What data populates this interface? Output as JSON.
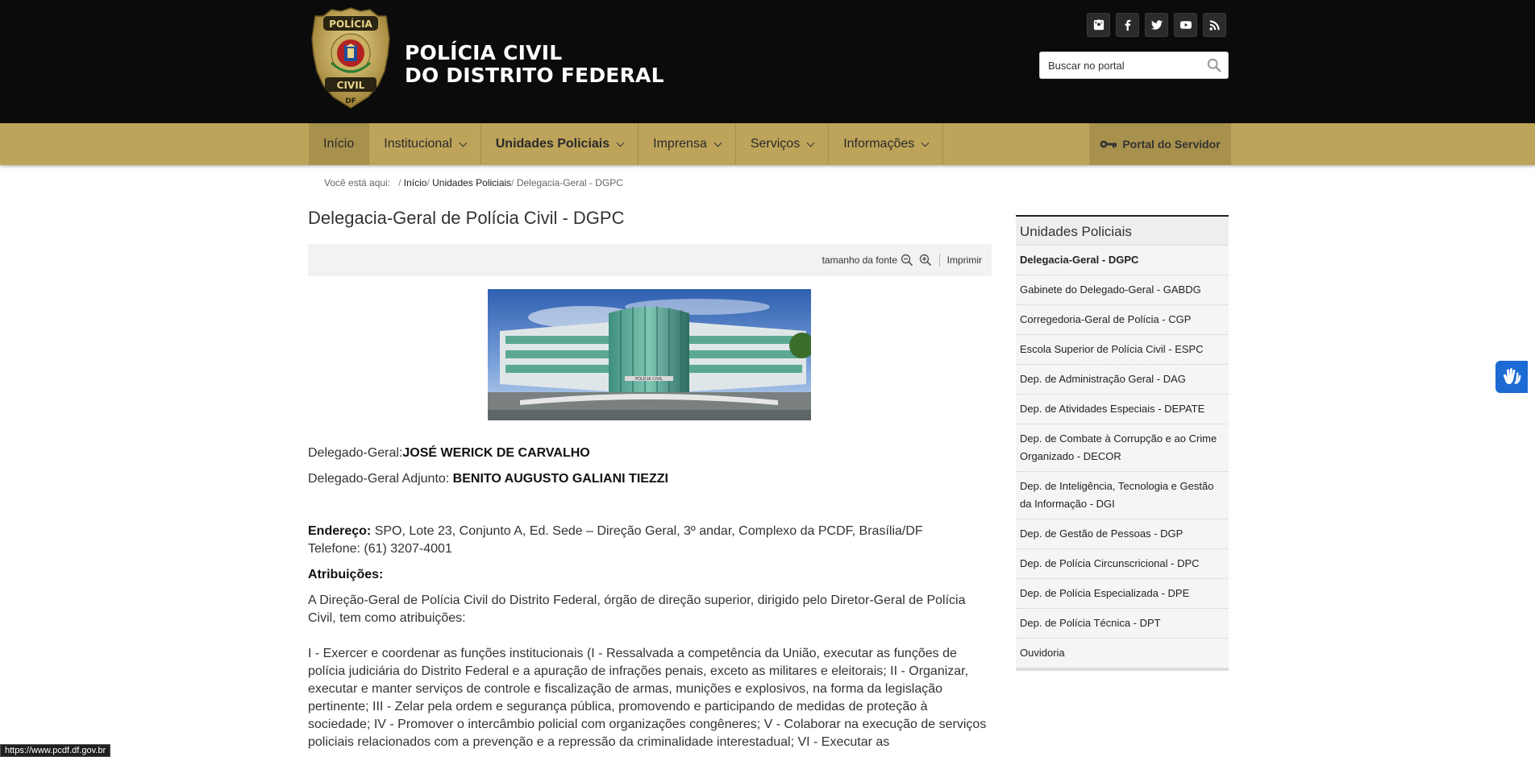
{
  "header": {
    "brand_line1": "POLÍCIA CIVIL",
    "brand_line2": "DO DISTRITO FEDERAL",
    "badge_text_top": "POLÍCIA",
    "badge_text_bottom": "CIVIL",
    "badge_text_df": "DF",
    "search_placeholder": "Buscar no portal",
    "socials": [
      "instagram-icon",
      "facebook-icon",
      "twitter-icon",
      "youtube-icon",
      "rss-icon"
    ]
  },
  "nav": {
    "items": [
      {
        "label": "Início"
      },
      {
        "label": "Institucional"
      },
      {
        "label": "Unidades Policiais"
      },
      {
        "label": "Imprensa"
      },
      {
        "label": "Serviços"
      },
      {
        "label": "Informações"
      }
    ],
    "portal_label": "Portal do Servidor"
  },
  "breadcrumb": {
    "prefix": "Você está aqui:",
    "home": "Início",
    "section": "Unidades Policiais",
    "current": "Delegacia-Geral - DGPC"
  },
  "main": {
    "title": "Delegacia-Geral de Polícia Civil - DGPC",
    "font_size_label": "tamanho da fonte",
    "print_label": "Imprimir",
    "building_sign": "POLÍCIA CIVIL",
    "delegado_label": "Delegado-Geral:",
    "delegado_name": "JOSÉ WERICK DE CARVALHO",
    "adjunto_label": "Delegado-Geral Adjunto: ",
    "adjunto_name": "BENITO AUGUSTO GALIANI TIEZZI",
    "endereco_label": "Endereço:",
    "endereco_value": " SPO, Lote 23, Conjunto A, Ed. Sede – Direção Geral, 3º andar, Complexo da PCDF, Brasília/DF",
    "telefone": "Telefone: (61) 3207-4001",
    "atribuicoes_label": "Atribuições:",
    "intro": "A Direção-Geral de Polícia Civil do Distrito Federal, órgão de direção superior, dirigido pelo Diretor-Geral de Polícia Civil, tem como atribuições:",
    "body": "I - Exercer e coordenar as funções institucionais (I - Ressalvada a competência da União, executar as funções de polícia judiciária do Distrito Federal e a apuração de infrações penais, exceto as militares e eleitorais; II - Organizar, executar e manter serviços de controle e fiscalização de armas, munições e explosivos, na forma da legislação pertinente; III - Zelar pela ordem e segurança pública, promovendo e participando de medidas de proteção à sociedade; IV - Promover o intercâmbio policial com organizações congêneres; V - Colaborar na execução de serviços policiais relacionados com a prevenção e a repressão da criminalidade interestadual; VI - Executar as"
  },
  "sidebar": {
    "title": "Unidades Policiais",
    "items": [
      "Delegacia-Geral - DGPC",
      "Gabinete do Delegado-Geral - GABDG",
      "Corregedoria-Geral de Polícia - CGP",
      "Escola Superior de Polícia Civil - ESPC",
      "Dep. de Administração Geral - DAG",
      "Dep. de Atividades Especiais - DEPATE",
      "Dep. de Combate à Corrupção e ao Crime Organizado - DECOR",
      "Dep. de Inteligência, Tecnologia e Gestão da Informação - DGI",
      "Dep. de Gestão de Pessoas - DGP",
      "Dep. de Polícia Circunscricional - DPC",
      "Dep. de Polícia Especializada - DPE",
      "Dep. de Polícia Técnica - DPT",
      "Ouvidoria"
    ]
  },
  "status_url": "https://www.pcdf.df.gov.br",
  "colors": {
    "header_bg": "#0b0b0b",
    "nav_gold": "#bda45a",
    "nav_active": "#a8914d",
    "accessibility_blue": "#1c6ad3"
  }
}
